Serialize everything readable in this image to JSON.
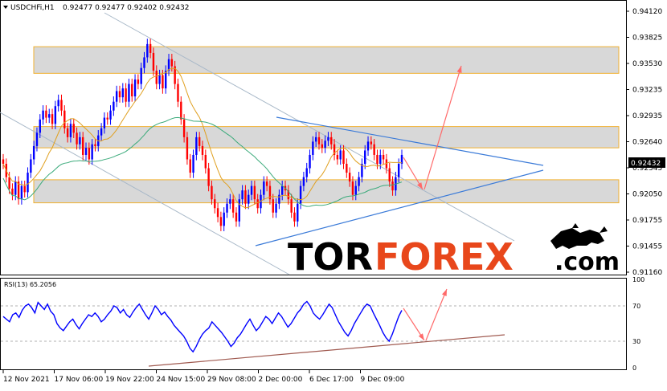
{
  "header": {
    "symbol": "USDCHFi,H1",
    "ohlc": "0.92477 0.92477 0.92402 0.92432"
  },
  "logo": {
    "part1": "TOR",
    "part2": "FOREX",
    "part3": ".com"
  },
  "colors": {
    "candle_up": "#0000ff",
    "candle_down": "#ff0000",
    "ma_fast": "#e0a020",
    "ma_slow": "#3aaa7a",
    "zone_fill": "#d8d8d8",
    "zone_border": "#f0b030",
    "channel": "#a8b8c8",
    "triangle": "#3a7ad8",
    "arrow": "#ff6a6a",
    "rsi_line": "#0000ff",
    "rsi_trend": "#a05a50",
    "price_tag_bg": "#000000"
  },
  "chart_data": [
    {
      "type": "candlestick",
      "panel": "price",
      "y_ticks": [
        "0.94120",
        "0.93825",
        "0.93530",
        "0.93235",
        "0.92935",
        "0.92640",
        "0.92345",
        "0.92050",
        "0.91755",
        "0.91455",
        "0.91160"
      ],
      "ylim": [
        0.9116,
        0.9412
      ],
      "current_price": "0.92432",
      "x_ticks": [
        "12 Nov 2021",
        "17 Nov 06:00",
        "19 Nov 22:00",
        "24 Nov 15:00",
        "29 Nov 08:00",
        "2 Dec 00:00",
        "6 Dec 17:00",
        "9 Dec 09:00"
      ],
      "zones": [
        {
          "low": 0.9342,
          "high": 0.9372
        },
        {
          "low": 0.9258,
          "high": 0.9282
        },
        {
          "low": 0.9196,
          "high": 0.9222
        }
      ],
      "closes": [
        0.924,
        0.9225,
        0.9212,
        0.9205,
        0.922,
        0.92,
        0.9215,
        0.9208,
        0.923,
        0.9245,
        0.926,
        0.9275,
        0.929,
        0.93,
        0.9292,
        0.9296,
        0.9285,
        0.9305,
        0.9312,
        0.93,
        0.928,
        0.927,
        0.9285,
        0.9275,
        0.9262,
        0.927,
        0.925,
        0.9258,
        0.9245,
        0.9262,
        0.926,
        0.9272,
        0.928,
        0.9292,
        0.929,
        0.93,
        0.931,
        0.9322,
        0.9315,
        0.9325,
        0.931,
        0.933,
        0.9316,
        0.9335,
        0.933,
        0.9348,
        0.936,
        0.9375,
        0.9365,
        0.9345,
        0.933,
        0.934,
        0.9325,
        0.9345,
        0.9358,
        0.935,
        0.933,
        0.931,
        0.929,
        0.927,
        0.9245,
        0.923,
        0.925,
        0.927,
        0.926,
        0.925,
        0.9235,
        0.9215,
        0.92,
        0.919,
        0.918,
        0.917,
        0.9185,
        0.9195,
        0.92,
        0.9185,
        0.9175,
        0.92,
        0.921,
        0.9195,
        0.9205,
        0.9215,
        0.92,
        0.919,
        0.9205,
        0.922,
        0.9215,
        0.92,
        0.9185,
        0.9195,
        0.9205,
        0.9215,
        0.921,
        0.92,
        0.9185,
        0.9175,
        0.9195,
        0.9215,
        0.9225,
        0.9235,
        0.925,
        0.9265,
        0.927,
        0.9262,
        0.9258,
        0.9266,
        0.927,
        0.9262,
        0.925,
        0.9245,
        0.9255,
        0.924,
        0.923,
        0.922,
        0.9205,
        0.9215,
        0.9225,
        0.924,
        0.9255,
        0.9265,
        0.9262,
        0.925,
        0.924,
        0.925,
        0.9245,
        0.9235,
        0.922,
        0.921,
        0.9225,
        0.924,
        0.925
      ],
      "series": [
        {
          "values_ref": "ma_fast",
          "period": "fast"
        },
        {
          "values_ref": "ma_slow",
          "period": "slow"
        }
      ]
    },
    {
      "type": "line",
      "panel": "rsi",
      "title": "RSI(13) 65.2056",
      "y_ticks": [
        "100",
        "70",
        "30",
        "0"
      ],
      "ylim": [
        0,
        100
      ],
      "values": [
        58,
        55,
        52,
        60,
        62,
        57,
        65,
        70,
        72,
        68,
        62,
        74,
        70,
        66,
        72,
        64,
        60,
        50,
        45,
        42,
        47,
        52,
        55,
        49,
        44,
        50,
        55,
        60,
        58,
        62,
        58,
        52,
        55,
        60,
        64,
        70,
        68,
        62,
        66,
        60,
        57,
        63,
        68,
        72,
        66,
        60,
        55,
        62,
        70,
        66,
        60,
        63,
        58,
        54,
        48,
        44,
        40,
        36,
        30,
        22,
        18,
        24,
        32,
        38,
        42,
        45,
        52,
        48,
        44,
        40,
        35,
        30,
        24,
        28,
        34,
        38,
        44,
        50,
        55,
        48,
        42,
        46,
        52,
        58,
        55,
        50,
        56,
        62,
        58,
        52,
        46,
        50,
        56,
        62,
        66,
        72,
        75,
        70,
        62,
        58,
        55,
        60,
        66,
        72,
        68,
        60,
        52,
        46,
        40,
        36,
        42,
        50,
        56,
        62,
        68,
        72,
        70,
        62,
        55,
        48,
        40,
        34,
        30,
        38,
        48,
        58,
        65
      ]
    }
  ]
}
